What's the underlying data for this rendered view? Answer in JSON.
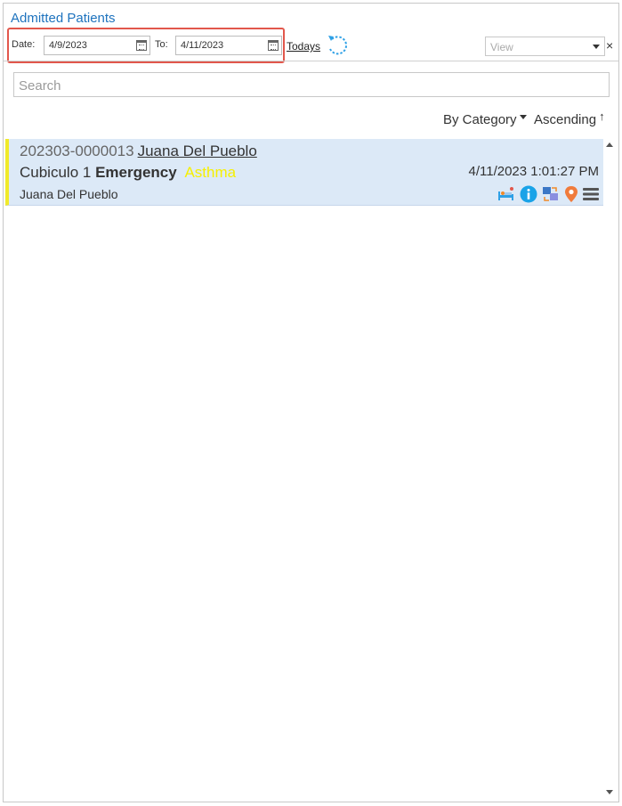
{
  "header": {
    "title": "Admitted Patients"
  },
  "filters": {
    "date_label": "Date:",
    "date_from": "4/9/2023",
    "to_label": "To:",
    "date_to": "4/11/2023",
    "todays_link": "Todays",
    "view_placeholder": "View",
    "view_clear": "×"
  },
  "search": {
    "placeholder": "Search"
  },
  "sort": {
    "category_label": "By Category",
    "order_label": "Ascending",
    "order_icon": "↑"
  },
  "patients": [
    {
      "id": "202303-0000013",
      "name": "Juana Del Pueblo",
      "location": "Cubiculo 1",
      "department": "Emergency",
      "condition": "Asthma",
      "datetime": "4/11/2023 1:01:27 PM",
      "doctor": "Juana Del Pueblo",
      "flag_color": "#f1ea2a",
      "icons": [
        "bed-icon",
        "info-icon",
        "transfer-icon",
        "location-pin-icon",
        "menu-icon"
      ]
    }
  ],
  "colors": {
    "accent": "#1e73be",
    "highlight_box": "#e2574c",
    "row_bg": "#dce9f7",
    "condition": "#f6f000"
  }
}
